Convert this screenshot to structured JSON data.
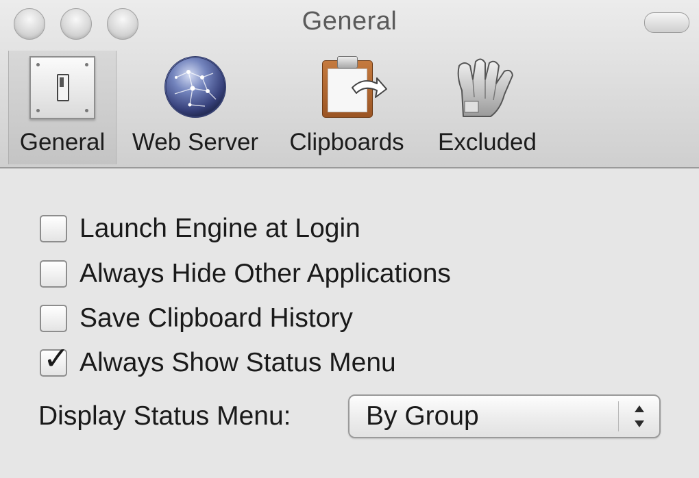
{
  "window": {
    "title": "General"
  },
  "toolbar": {
    "tabs": [
      {
        "label": "General",
        "icon": "light-switch-icon",
        "selected": true
      },
      {
        "label": "Web Server",
        "icon": "globe-icon",
        "selected": false
      },
      {
        "label": "Clipboards",
        "icon": "clipboard-icon",
        "selected": false
      },
      {
        "label": "Excluded",
        "icon": "glove-icon",
        "selected": false
      }
    ]
  },
  "options": [
    {
      "label": "Launch Engine at Login",
      "checked": false
    },
    {
      "label": "Always Hide Other Applications",
      "checked": false
    },
    {
      "label": "Save Clipboard History",
      "checked": false
    },
    {
      "label": "Always Show Status Menu",
      "checked": true
    }
  ],
  "display_status_menu": {
    "label": "Display Status Menu:",
    "selected": "By Group"
  },
  "colors": {
    "window_bg": "#e6e6e6",
    "text": "#1a1a1a",
    "title_text": "#5a5a5a"
  }
}
